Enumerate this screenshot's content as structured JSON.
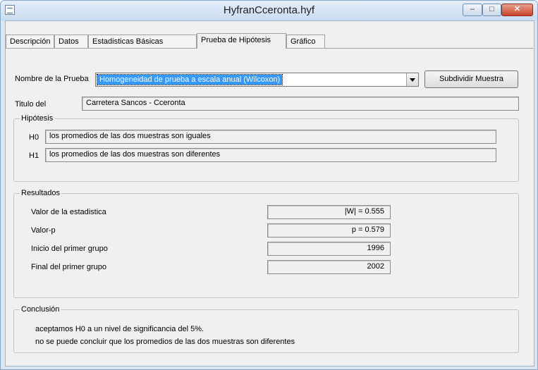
{
  "window": {
    "title": "HyfranCceronta.hyf",
    "minimize": "–",
    "maximize": "□",
    "close": "✕"
  },
  "tabs": [
    {
      "label": "Descripción"
    },
    {
      "label": "Datos"
    },
    {
      "label": "Estadisticas Básicas"
    },
    {
      "label": "Prueba de Hipótesis"
    },
    {
      "label": "Gráfico"
    }
  ],
  "test": {
    "name_label": "Nombre de la Prueba",
    "selected": "Homogeneidad de prueba a escala anual (Wilcoxon)",
    "split_button": "Subdividir Muestra"
  },
  "titulo": {
    "label": "Titulo del",
    "value": "Carretera Sancos - Cceronta"
  },
  "hipotesis": {
    "legend": "Hipótesis",
    "h0_label": "H0",
    "h0_value": "los promedios de las dos muestras son iguales",
    "h1_label": "H1",
    "h1_value": "los promedios de las dos muestras son diferentes"
  },
  "resultados": {
    "legend": "Resultados",
    "rows": [
      {
        "label": "Valor de la estadistica",
        "value": "|W| =  0.555"
      },
      {
        "label": "Valor-p",
        "value": "p =  0.579"
      },
      {
        "label": "Inicio del primer grupo",
        "value": "1996"
      },
      {
        "label": "Final del primer grupo",
        "value": "2002"
      }
    ]
  },
  "conclusion": {
    "legend": "Conclusión",
    "line1": "aceptamos H0 a un nivel de significancia del 5%.",
    "line2": "no se puede concluir que los promedios de las dos muestras son diferentes"
  }
}
